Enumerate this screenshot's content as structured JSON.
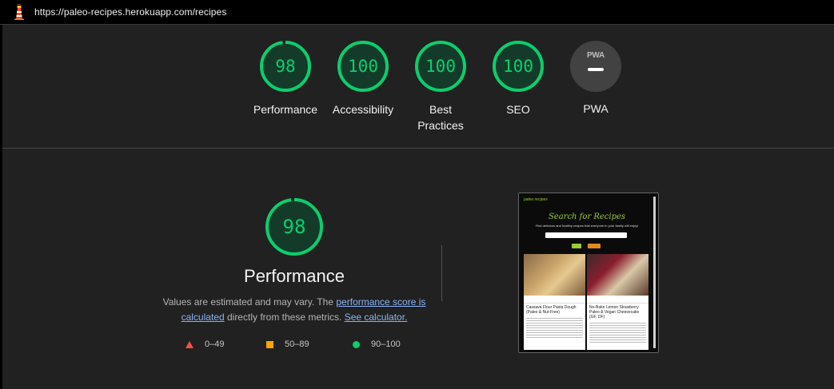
{
  "topbar": {
    "url": "https://paleo-recipes.herokuapp.com/recipes",
    "icon": "lighthouse-icon"
  },
  "colors": {
    "pass": "#0cce6b",
    "average": "#ffa400",
    "fail": "#ff4e42",
    "link": "#8ab4f8"
  },
  "gauges": [
    {
      "label": "Performance",
      "score": "98"
    },
    {
      "label": "Accessibility",
      "score": "100"
    },
    {
      "label": "Best Practices",
      "label_line1": "Best",
      "label_line2": "Practices",
      "score": "100"
    },
    {
      "label": "SEO",
      "score": "100"
    },
    {
      "label": "PWA",
      "badge_text": "PWA",
      "score": ""
    }
  ],
  "performance": {
    "score": "98",
    "title": "Performance",
    "desc_prefix": "Values are estimated and may vary. The ",
    "desc_link1": "performance score is calculated",
    "desc_middle": " directly from these metrics. ",
    "desc_link2": "See calculator.",
    "legend": [
      {
        "range": "0–49",
        "shape": "triangle"
      },
      {
        "range": "50–89",
        "shape": "square"
      },
      {
        "range": "90–100",
        "shape": "circle"
      }
    ]
  },
  "thumbnail": {
    "site_name": "paleo recipes",
    "heading": "Search for Recipes",
    "subheading": "Find delicious and healthy recipes that everyone in your family will enjoy!",
    "cards": [
      {
        "title": "Cassava Flour Pasta Dough (Paleo & Nut-Free)"
      },
      {
        "title": "No-Bake Lemon Strawberry Paleo & Vegan Cheesecake (GF, DF)"
      }
    ]
  }
}
